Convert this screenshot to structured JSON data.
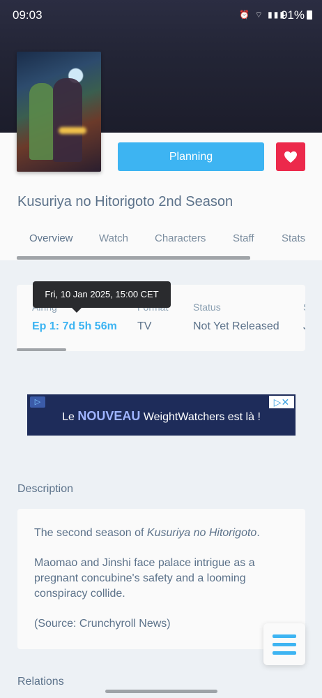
{
  "status_bar": {
    "time": "09:03",
    "battery": "91%"
  },
  "header": {
    "planning_label": "Planning",
    "title": "Kusuriya no Hitorigoto 2nd Season",
    "tabs": [
      {
        "label": "Overview",
        "active": true
      },
      {
        "label": "Watch"
      },
      {
        "label": "Characters"
      },
      {
        "label": "Staff"
      },
      {
        "label": "Stats"
      }
    ]
  },
  "airing": {
    "tooltip": "Fri, 10 Jan 2025, 15:00 CET",
    "fields": [
      {
        "label": "Airing",
        "value": "Ep 1: 7d 5h 56m"
      },
      {
        "label": "Format",
        "value": "TV"
      },
      {
        "label": "Status",
        "value": "Not Yet Released"
      },
      {
        "label": "S",
        "value": "J"
      }
    ]
  },
  "ad": {
    "prefix": "Le",
    "highlight": "NOUVEAU",
    "suffix": "WeightWatchers est là !"
  },
  "description": {
    "heading": "Description",
    "line1_prefix": "The second season of ",
    "line1_title": "Kusuriya no Hitorigoto",
    "line1_suffix": ".",
    "paragraph2": "Maomao and Jinshi face palace intrigue as a pregnant concubine's safety and a looming conspiracy collide.",
    "paragraph3": "(Source: Crunchyroll News)"
  },
  "relations": {
    "heading": "Relations"
  },
  "colors": {
    "accent": "#3db4f2",
    "favourite": "#ec294b",
    "text": "#5c728a"
  }
}
